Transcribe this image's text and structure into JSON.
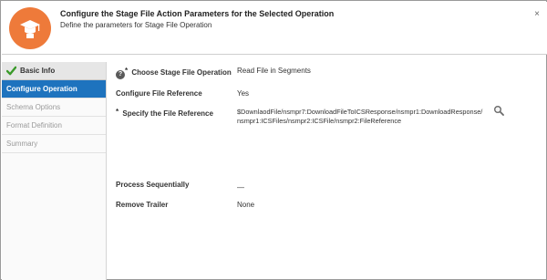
{
  "header": {
    "title": "Configure the Stage File Action Parameters for the Selected Operation",
    "subtitle": "Define the parameters for Stage File Operation",
    "close_glyph": "×",
    "logo_icon": "graduation-cap-icon",
    "logo_color": "#ee7a3a"
  },
  "sidebar": {
    "head": "Basic Info",
    "items": [
      {
        "label": "Configure Operation"
      },
      {
        "label": "Schema Options"
      },
      {
        "label": "Format Definition"
      },
      {
        "label": "Summary"
      }
    ],
    "active_color": "#1e73be",
    "check_color": "#3a9a2a"
  },
  "form": {
    "choose_op_label": "Choose Stage File Operation",
    "choose_op_help": "?",
    "choose_op_req": "*",
    "choose_op_value": "Read File in Segments",
    "configure_ref_label": "Configure File Reference",
    "configure_ref_value": "Yes",
    "specify_ref_req": "*",
    "specify_ref_label": "Specify the File Reference",
    "specify_ref_value": "$DownlaodFile/nsmpr7:DownloadFileToICSResponse/nsmpr1:DownloadResponse/nsmpr1:ICSFiles/nsmpr2:ICSFile/nsmpr2:FileReference",
    "process_seq_label": "Process Sequentially",
    "process_seq_value": "—",
    "remove_trailer_label": "Remove Trailer",
    "remove_trailer_value": "None"
  }
}
